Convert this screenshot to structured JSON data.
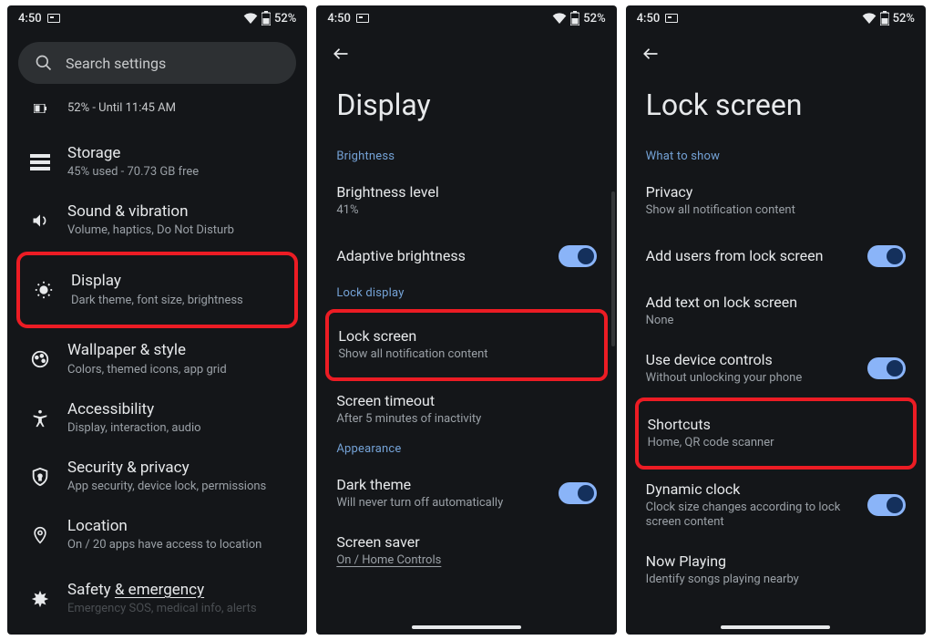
{
  "status": {
    "time": "4:50",
    "battery_pct": "52%"
  },
  "phone1": {
    "search_placeholder": "Search settings",
    "battery": {
      "label": "52% - Until 11:45 AM"
    },
    "items": [
      {
        "label": "Storage",
        "sub": "45% used - 70.73 GB free"
      },
      {
        "label": "Sound & vibration",
        "sub": "Volume, haptics, Do Not Disturb"
      },
      {
        "label": "Display",
        "sub": "Dark theme, font size, brightness"
      },
      {
        "label": "Wallpaper & style",
        "sub": "Colors, themed icons, app grid"
      },
      {
        "label": "Accessibility",
        "sub": "Display, interaction, audio"
      },
      {
        "label": "Security & privacy",
        "sub": "App security, device lock, permissions"
      },
      {
        "label": "Location",
        "sub": "On / 20 apps have access to location"
      },
      {
        "label": "Safety & emergency",
        "sub": "Emergency SOS, medical info, alerts"
      }
    ]
  },
  "phone2": {
    "title": "Display",
    "sections": {
      "brightness": "Brightness",
      "lock_display": "Lock display",
      "appearance": "Appearance"
    },
    "items": {
      "brightness_level": {
        "label": "Brightness level",
        "sub": "41%"
      },
      "adaptive": {
        "label": "Adaptive brightness"
      },
      "lock_screen": {
        "label": "Lock screen",
        "sub": "Show all notification content"
      },
      "screen_timeout": {
        "label": "Screen timeout",
        "sub": "After 5 minutes of inactivity"
      },
      "dark_theme": {
        "label": "Dark theme",
        "sub": "Will never turn off automatically"
      },
      "screen_saver": {
        "label": "Screen saver",
        "sub": "On / Home Controls"
      }
    }
  },
  "phone3": {
    "title": "Lock screen",
    "sections": {
      "what_to_show": "What to show"
    },
    "items": {
      "privacy": {
        "label": "Privacy",
        "sub": "Show all notification content"
      },
      "add_users": {
        "label": "Add users from lock screen"
      },
      "add_text": {
        "label": "Add text on lock screen",
        "sub": "None"
      },
      "device_controls": {
        "label": "Use device controls",
        "sub": "Without unlocking your phone"
      },
      "shortcuts": {
        "label": "Shortcuts",
        "sub": "Home, QR code scanner"
      },
      "dynamic_clock": {
        "label": "Dynamic clock",
        "sub": "Clock size changes according to lock screen content"
      },
      "now_playing": {
        "label": "Now Playing",
        "sub": "Identify songs playing nearby"
      }
    }
  }
}
